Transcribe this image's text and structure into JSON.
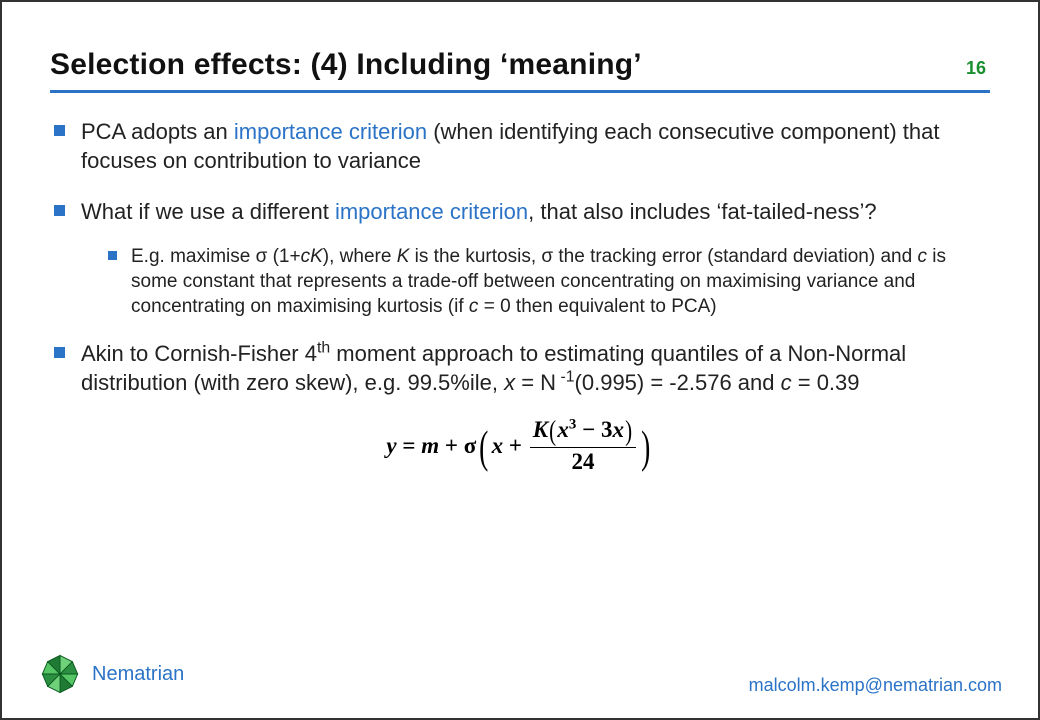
{
  "page_number": "16",
  "title": "Selection effects: (4) Including ‘meaning’",
  "bullets": {
    "b1_pre": "PCA adopts an ",
    "b1_hl": "importance criterion",
    "b1_post": " (when identifying each consecutive component) that focuses on contribution to variance",
    "b2_pre": "What if we use a different ",
    "b2_hl": "importance criterion",
    "b2_post": ", that also includes ‘fat-tailed-ness’?",
    "b2a_1": "E.g. maximise σ (1+",
    "b2a_cK_c": "c",
    "b2a_cK_K": "K",
    "b2a_2": "), where ",
    "b2a_K": "K",
    "b2a_3": " is the kurtosis, σ the tracking error (standard deviation) and ",
    "b2a_c": "c",
    "b2a_4": " is some constant that represents a trade-off between concentrating on maximising variance and concentrating on maximising kurtosis (if ",
    "b2a_c2": "c",
    "b2a_5": " = 0 then equivalent to PCA)",
    "b3_1": "Akin to Cornish-Fisher 4",
    "b3_sup": "th",
    "b3_2": " moment approach to estimating quantiles of a Non-Normal distribution (with zero skew), e.g. 99.5%ile, ",
    "b3_x": "x",
    "b3_3": " = N",
    "b3_exp": " -1",
    "b3_4": "(0.995) = -2.576 and ",
    "b3_c": "c",
    "b3_5": " = 0.39"
  },
  "formula": {
    "y": "y",
    "eq1": " = ",
    "m": "m",
    "plus1": " + ",
    "sigma": "σ",
    "x": "x",
    "plus2": " + ",
    "K": "K",
    "lpar_inner": "(",
    "x3": "x",
    "exp3": "3",
    "minus": " − ",
    "three": "3",
    "x2": "x",
    "rpar_inner": ")",
    "den": "24"
  },
  "footer": {
    "brand": "Nematrian",
    "contact": "malcolm.kemp@nematrian.com"
  }
}
